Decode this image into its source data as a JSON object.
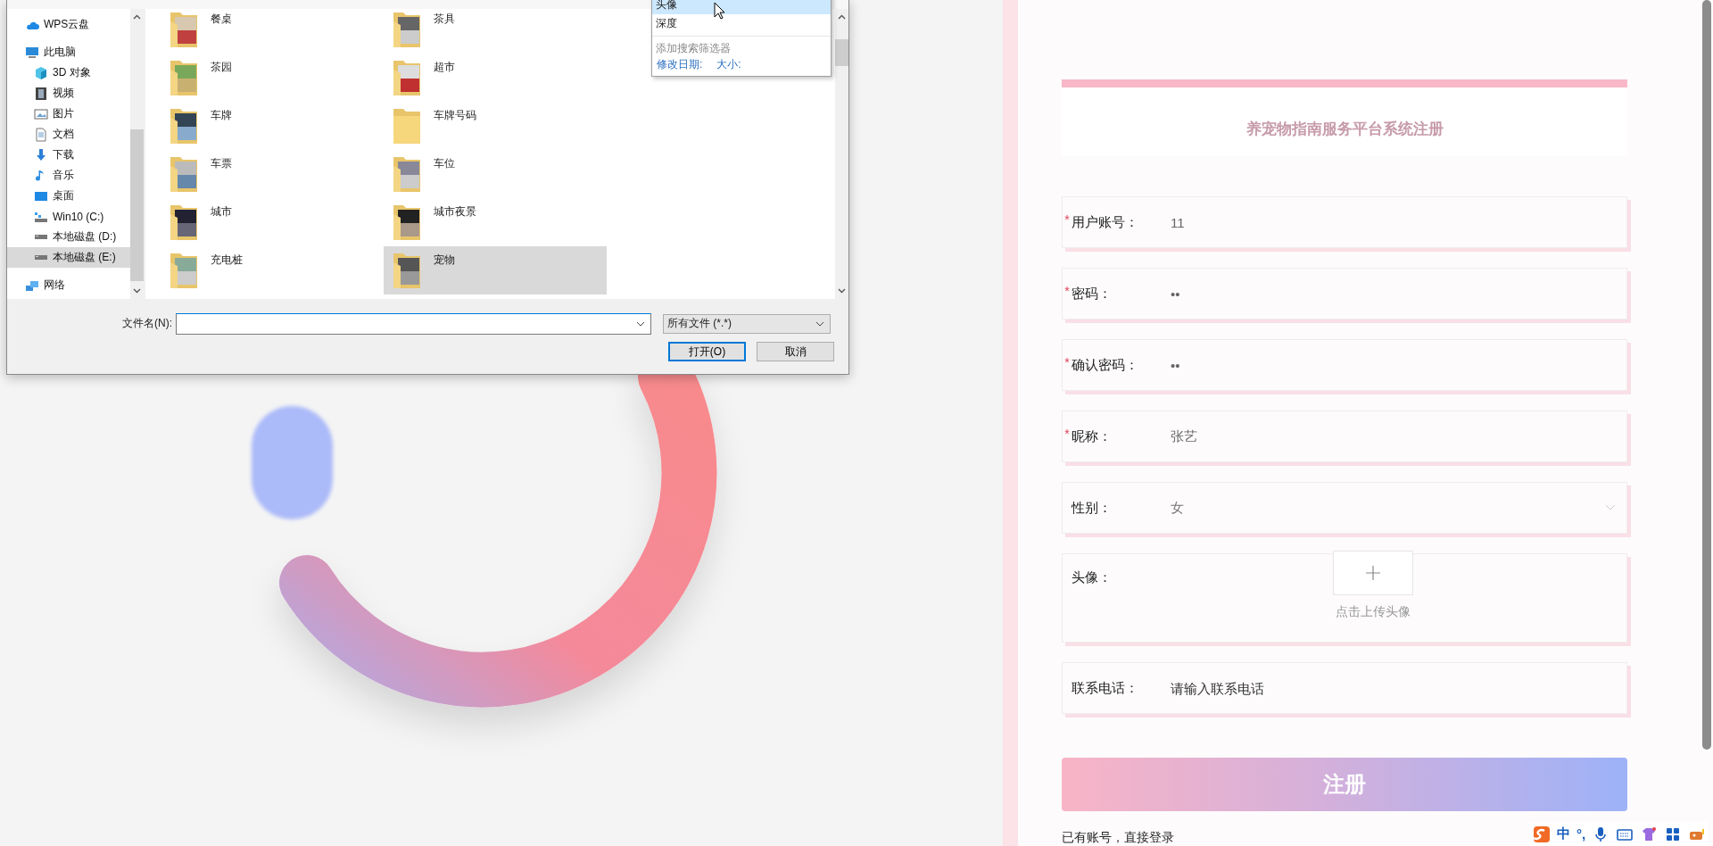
{
  "file_dialog": {
    "search_suggestions": {
      "items": [
        {
          "label": "头像",
          "selected": true
        },
        {
          "label": "深度",
          "selected": false
        }
      ],
      "filter_heading": "添加搜索筛选器",
      "filters": [
        "修改日期:",
        "大小:"
      ]
    },
    "nav_items": [
      {
        "kind": "cloud",
        "label": "WPS云盘",
        "selected": false
      },
      {
        "kind": "pc",
        "label": "此电脑",
        "selected": false,
        "children": [
          {
            "kind": "cube",
            "label": "3D 对象",
            "selected": false
          },
          {
            "kind": "film",
            "label": "视频",
            "selected": false
          },
          {
            "kind": "image",
            "label": "图片",
            "selected": false
          },
          {
            "kind": "doc",
            "label": "文档",
            "selected": false
          },
          {
            "kind": "download",
            "label": "下载",
            "selected": false
          },
          {
            "kind": "music",
            "label": "音乐",
            "selected": false
          },
          {
            "kind": "desktop",
            "label": "桌面",
            "selected": false
          },
          {
            "kind": "system-drive",
            "label": "Win10 (C:)",
            "selected": false
          },
          {
            "kind": "drive",
            "label": "本地磁盘 (D:)",
            "selected": false
          },
          {
            "kind": "drive",
            "label": "本地磁盘 (E:)",
            "selected": true
          }
        ]
      },
      {
        "kind": "network",
        "label": "网络",
        "selected": false
      }
    ],
    "folders": [
      {
        "name": "餐桌",
        "kind": "photo",
        "selected": false
      },
      {
        "name": "茶具",
        "kind": "photo",
        "selected": false
      },
      {
        "name": "茶园",
        "kind": "photo",
        "selected": false
      },
      {
        "name": "超市",
        "kind": "photo",
        "selected": false
      },
      {
        "name": "车牌",
        "kind": "photo",
        "selected": false
      },
      {
        "name": "车牌号码",
        "kind": "plain",
        "selected": false
      },
      {
        "name": "车票",
        "kind": "photo",
        "selected": false
      },
      {
        "name": "车位",
        "kind": "photo",
        "selected": false
      },
      {
        "name": "城市",
        "kind": "photo",
        "selected": false
      },
      {
        "name": "城市夜景",
        "kind": "photo",
        "selected": false
      },
      {
        "name": "充电桩",
        "kind": "photo",
        "selected": false
      },
      {
        "name": "宠物",
        "kind": "photo",
        "selected": true
      }
    ],
    "filename": {
      "label": "文件名(N):"
    },
    "file_type": "所有文件 (*.*)",
    "buttons": [
      {
        "label": "打开(O)",
        "default": true
      },
      {
        "label": "取消",
        "default": false
      }
    ]
  },
  "register": {
    "title": "养宠物指南服务平台系统注册",
    "fields": [
      {
        "kind": "text",
        "required_mark": "*",
        "label": "用户账号：",
        "value": "11"
      },
      {
        "kind": "text",
        "required_mark": "*",
        "label": "密码：",
        "value": "••"
      },
      {
        "kind": "text",
        "required_mark": "*",
        "label": "确认密码：",
        "value": "••"
      },
      {
        "kind": "text",
        "required_mark": "*",
        "label": "昵称：",
        "value": "张艺"
      },
      {
        "kind": "select",
        "label": "性别：",
        "value": "女"
      },
      {
        "kind": "upload",
        "label": "头像：",
        "caption": "点击上传头像"
      },
      {
        "kind": "text",
        "label": "联系电话：",
        "placeholder": "请输入联系电话"
      }
    ],
    "submit": "注册",
    "login_link": "已有账号，直接登录"
  },
  "ime_toolbar": {
    "items": [
      {
        "kind": "logo"
      },
      {
        "kind": "text",
        "label": "中"
      },
      {
        "kind": "text",
        "label": "°,"
      },
      {
        "kind": "mic"
      },
      {
        "kind": "keyboard"
      },
      {
        "kind": "skin"
      },
      {
        "kind": "apps"
      },
      {
        "kind": "tools"
      }
    ]
  }
}
